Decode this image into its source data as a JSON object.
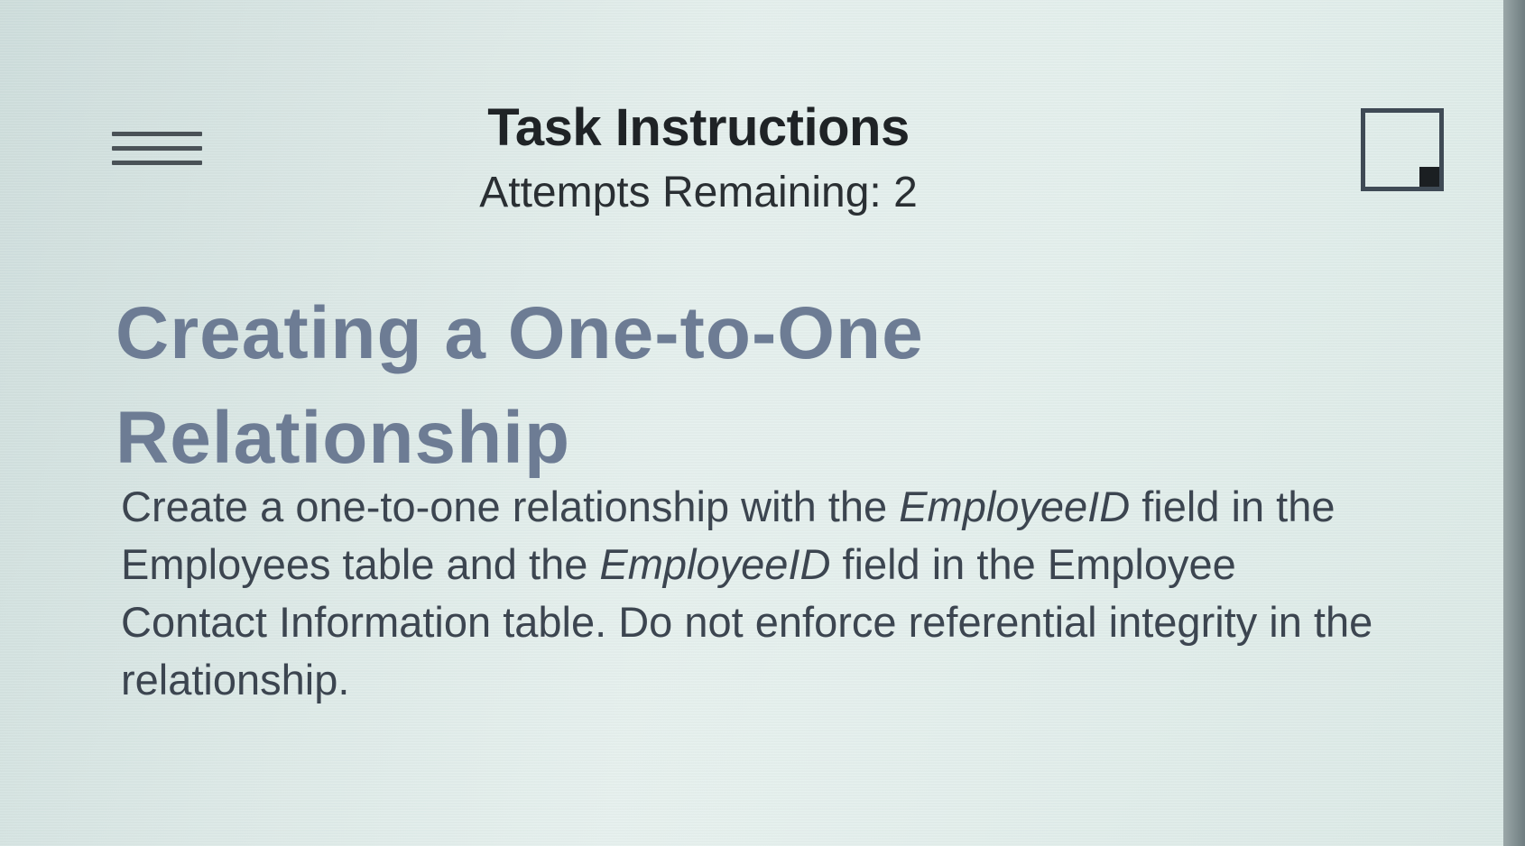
{
  "header": {
    "title": "Task Instructions",
    "attempts": "Attempts Remaining: 2"
  },
  "task": {
    "heading": "Creating a One-to-One Relationship",
    "body": {
      "part1": "Create a one-to-one relationship with the ",
      "field1": "EmployeeID",
      "part2": " field in the Employees table and the ",
      "field2": "EmployeeID",
      "part3": " field in the Employee Contact Information table. Do not enforce referential integrity in the relationship."
    }
  },
  "icons": {
    "menu": "hamburger-menu-icon",
    "expand": "expand-window-icon"
  },
  "colors": {
    "heading": "#6d7c94",
    "body_text": "#3c4550",
    "title_text": "#1f2326"
  }
}
